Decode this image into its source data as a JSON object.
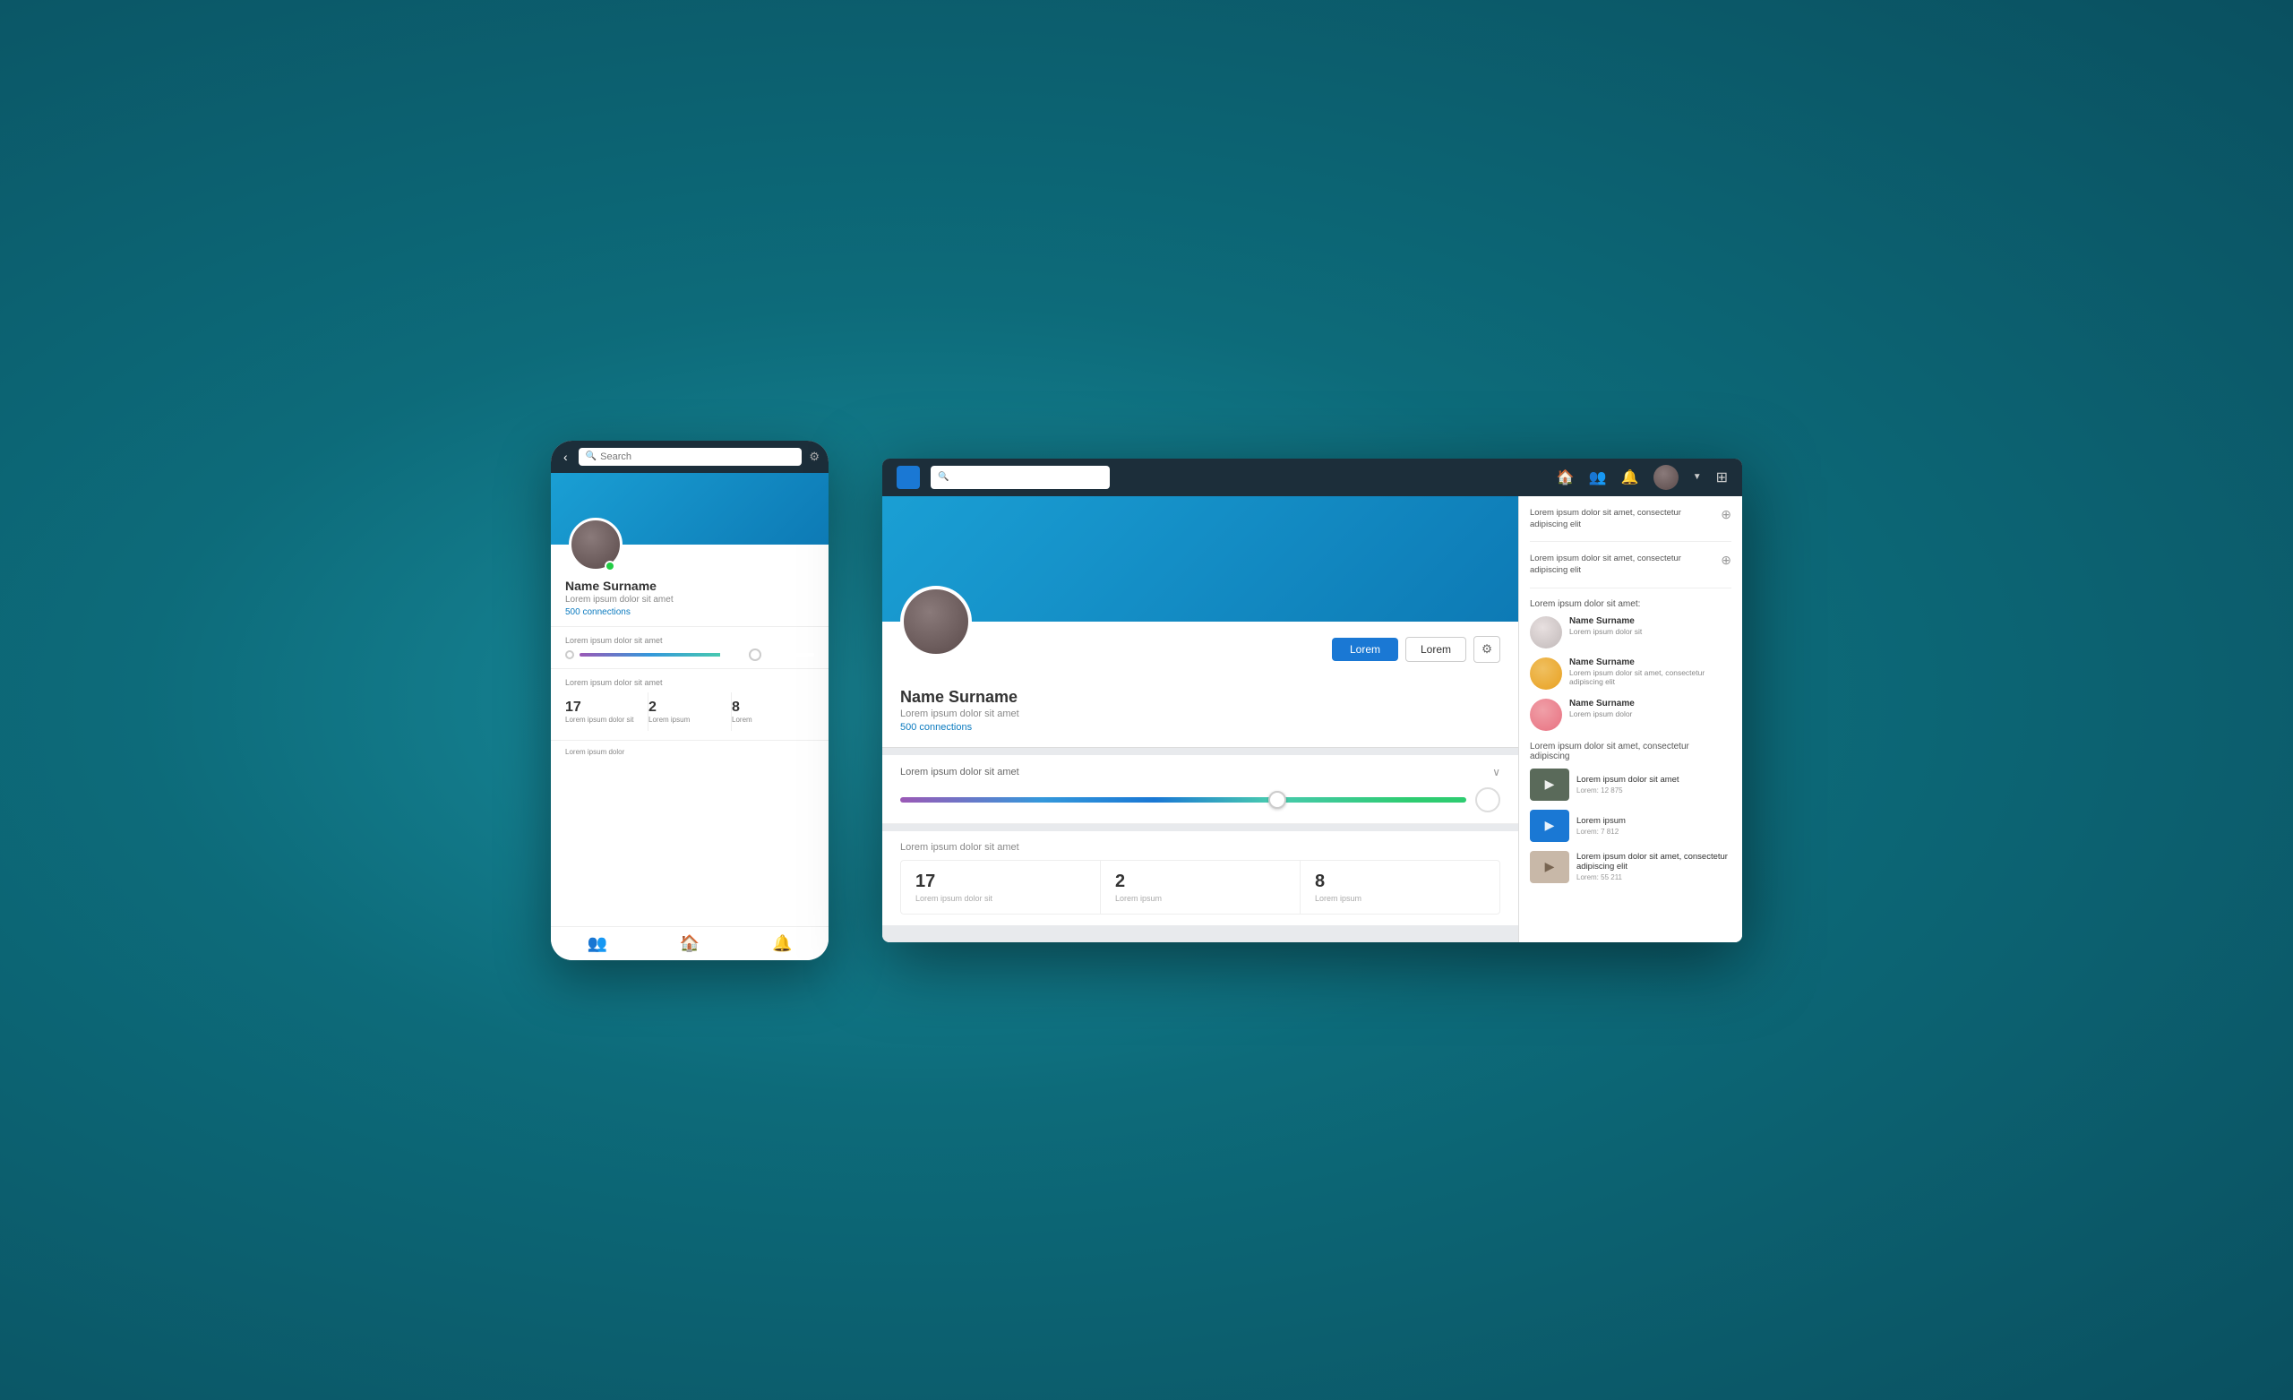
{
  "background": "#0d6b7a",
  "mobile": {
    "search_placeholder": "Search",
    "back_icon": "‹",
    "gear_icon": "⚙",
    "profile_name": "Name Surname",
    "profile_bio": "Lorem ipsum dolor sit amet",
    "connections": "500 connections",
    "slider_label": "Lorem ipsum dolor sit amet",
    "stats_label": "Lorem ipsum dolor sit amet",
    "stats": [
      {
        "number": "17",
        "label": "Lorem ipsum dolor sit"
      },
      {
        "number": "2",
        "label": "Lorem ipsum"
      },
      {
        "number": "8",
        "label": "Lorem"
      }
    ],
    "bottom_label": "Lorem ipsum dolor",
    "nav_icons": [
      "👥",
      "🏠",
      "🔔"
    ]
  },
  "desktop": {
    "search_placeholder": "",
    "logo_color": "#1a78d4",
    "nav_icons": {
      "home": "🏠",
      "people": "👥",
      "bell": "🔔",
      "grid": "⋮⋮"
    },
    "profile": {
      "name": "Name Surname",
      "bio": "Lorem ipsum dolor sit amet",
      "connections": "500 connections",
      "btn_primary": "Lorem",
      "btn_secondary": "Lorem"
    },
    "progress": {
      "label": "Lorem ipsum dolor sit amet",
      "chevron": "∨"
    },
    "stats": {
      "label": "Lorem ipsum dolor sit amet",
      "items": [
        {
          "number": "17",
          "label": "Lorem ipsum dolor sit"
        },
        {
          "number": "2",
          "label": "Lorem ipsum"
        },
        {
          "number": "8",
          "label": "Lorem ipsum"
        }
      ]
    },
    "sidebar": {
      "item1_text": "Lorem ipsum dolor sit amet, consectetur adipiscing elit",
      "item2_text": "Lorem ipsum dolor sit amet, consectetur adipiscing elit",
      "people_section_title": "Lorem ipsum dolor sit amet:",
      "people": [
        {
          "name": "Name Surname",
          "bio": "Lorem ipsum dolor sit",
          "avatar_color": "#e0dede"
        },
        {
          "name": "Name Surname",
          "bio": "Lorem ipsum dolor sit amet, consectetur adipiscing elit",
          "avatar_color": "#e8a020"
        },
        {
          "name": "Name Surname",
          "bio": "Lorem ipsum dolor",
          "avatar_color": "#e87080"
        }
      ],
      "video_section_title": "Lorem ipsum dolor sit amet, consectetur adipiscing",
      "videos": [
        {
          "title": "Lorem ipsum dolor sit amet",
          "meta": "Lorem: 12 875",
          "thumb_color": "#5a6a5a"
        },
        {
          "title": "Lorem ipsum",
          "meta": "Lorem: 7 812",
          "thumb_color": "#1a78d4"
        },
        {
          "title": "Lorem ipsum dolor sit amet, consectetur adipiscing elit",
          "meta": "Lorem: 55 211",
          "thumb_color": "#c8b8a8"
        }
      ]
    }
  }
}
